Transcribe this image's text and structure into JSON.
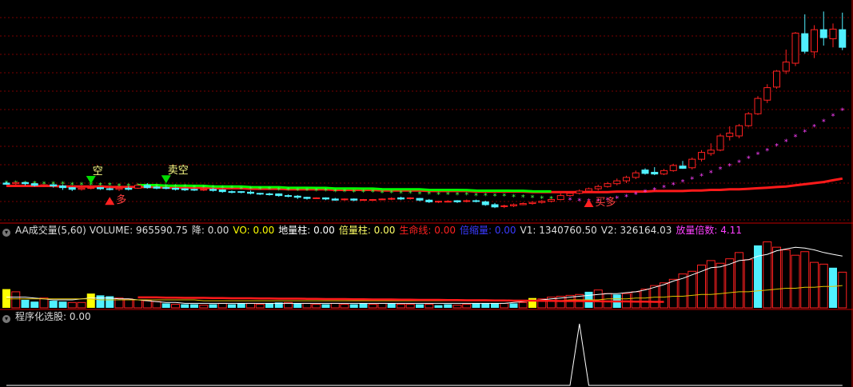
{
  "main_panel": {
    "signals": {
      "sell_short": "卖空",
      "short": "空",
      "many": "多",
      "buy_many": "买多"
    }
  },
  "volume_header": {
    "indicator": "AA成交量(5,60)",
    "items": [
      {
        "label": "VOLUME:",
        "value": "965590.75",
        "color": "#dddddd"
      },
      {
        "label": "降:",
        "value": "0.00",
        "color": "#dddddd"
      },
      {
        "label": "VO:",
        "value": "0.00",
        "color": "#ffff00"
      },
      {
        "label": "地量柱:",
        "value": "0.00",
        "color": "#ffffff"
      },
      {
        "label": "倍量柱:",
        "value": "0.00",
        "color": "#ffff66"
      },
      {
        "label": "生命线:",
        "value": "0.00",
        "color": "#ff2020"
      },
      {
        "label": "倍缩量:",
        "value": "0.00",
        "color": "#3a3aff"
      },
      {
        "label": "V1:",
        "value": "1340760.50",
        "color": "#dddddd"
      },
      {
        "label": "V2:",
        "value": "326164.03",
        "color": "#dddddd"
      },
      {
        "label": "放量倍数:",
        "value": "4.11",
        "color": "#ff40ff"
      }
    ]
  },
  "screener_header": {
    "label": "程序化选股",
    "value": ": 0.00"
  },
  "colors": {
    "up": "#ff2020",
    "down": "#50f0ff",
    "lifeline": "#ff1a1a",
    "trendline": "#00ff00",
    "dots": "#ff40ff",
    "grid": "#7a0000",
    "yellow_bar": "#ffff00"
  },
  "chart_data": [
    {
      "type": "candlestick",
      "candles": [
        [
          20.4,
          20.7,
          20.2,
          20.1
        ],
        [
          20.3,
          20.6,
          20.5,
          20.0
        ],
        [
          20.5,
          20.6,
          20.3,
          20.0
        ],
        [
          20.3,
          20.4,
          20.0,
          19.8
        ],
        [
          20.0,
          20.2,
          20.1,
          19.7
        ],
        [
          20.1,
          20.3,
          19.9,
          19.6
        ],
        [
          19.9,
          20.1,
          19.6,
          19.2
        ],
        [
          19.6,
          19.7,
          19.3,
          19.0
        ],
        [
          19.3,
          19.6,
          19.5,
          19.1
        ],
        [
          19.5,
          19.7,
          19.6,
          19.3
        ],
        [
          19.6,
          19.7,
          19.4,
          19.2
        ],
        [
          19.4,
          19.6,
          19.3,
          19.1
        ],
        [
          19.3,
          19.6,
          19.5,
          19.0
        ],
        [
          19.5,
          19.8,
          19.3,
          19.1
        ],
        [
          19.5,
          20.2,
          20.0,
          19.4
        ],
        [
          20.0,
          20.4,
          19.6,
          19.4
        ],
        [
          19.7,
          19.9,
          19.5,
          19.3
        ],
        [
          19.6,
          19.8,
          19.5,
          19.3
        ],
        [
          19.5,
          19.6,
          19.3,
          19.1
        ],
        [
          19.4,
          19.5,
          19.2,
          19.0
        ],
        [
          19.3,
          19.4,
          19.2,
          19.0
        ],
        [
          19.2,
          19.4,
          19.3,
          19.0
        ],
        [
          19.3,
          19.5,
          19.1,
          18.9
        ],
        [
          19.2,
          19.3,
          18.9,
          18.7
        ],
        [
          18.9,
          19.1,
          18.8,
          18.6
        ],
        [
          18.9,
          19.0,
          18.8,
          18.6
        ],
        [
          18.8,
          19.1,
          18.6,
          18.4
        ],
        [
          18.6,
          18.7,
          18.5,
          18.3
        ],
        [
          18.5,
          18.7,
          18.4,
          18.2
        ],
        [
          18.5,
          18.6,
          18.2,
          18.0
        ],
        [
          18.2,
          18.4,
          18.1,
          17.9
        ],
        [
          18.1,
          18.3,
          17.9,
          17.6
        ],
        [
          17.9,
          18.0,
          17.7,
          17.5
        ],
        [
          17.8,
          17.9,
          17.8,
          17.6
        ],
        [
          17.8,
          17.9,
          17.6,
          17.4
        ],
        [
          17.6,
          17.8,
          17.4,
          17.3
        ],
        [
          17.5,
          17.7,
          17.6,
          17.3
        ],
        [
          17.6,
          17.7,
          17.4,
          17.2
        ],
        [
          17.5,
          17.6,
          17.5,
          17.3
        ],
        [
          17.4,
          17.6,
          17.5,
          17.3
        ],
        [
          17.5,
          17.7,
          17.6,
          17.4
        ],
        [
          17.6,
          17.9,
          17.7,
          17.4
        ],
        [
          17.8,
          18.0,
          17.6,
          17.4
        ],
        [
          17.7,
          17.9,
          17.8,
          17.5
        ],
        [
          17.7,
          17.8,
          17.4,
          17.2
        ],
        [
          17.4,
          17.6,
          17.1,
          16.9
        ],
        [
          17.1,
          17.3,
          17.2,
          16.9
        ],
        [
          17.2,
          17.4,
          17.2,
          17.0
        ],
        [
          17.3,
          17.4,
          17.1,
          16.9
        ],
        [
          17.2,
          17.5,
          17.3,
          17.0
        ],
        [
          17.3,
          17.5,
          17.2,
          17.0
        ],
        [
          17.1,
          17.3,
          16.6,
          16.4
        ],
        [
          16.6,
          16.9,
          16.2,
          16.0
        ],
        [
          16.3,
          16.6,
          16.4,
          16.0
        ],
        [
          16.4,
          16.8,
          16.6,
          16.2
        ],
        [
          16.6,
          17.0,
          16.8,
          16.5
        ],
        [
          16.8,
          17.2,
          17.0,
          16.6
        ],
        [
          17.0,
          17.4,
          17.2,
          16.8
        ],
        [
          17.2,
          17.6,
          17.5,
          17.0
        ],
        [
          17.5,
          18.6,
          18.2,
          17.4
        ],
        [
          18.2,
          18.8,
          18.6,
          18.0
        ],
        [
          18.6,
          19.3,
          19.0,
          18.4
        ],
        [
          19.0,
          19.6,
          19.4,
          18.7
        ],
        [
          19.4,
          20.1,
          19.8,
          19.1
        ],
        [
          19.8,
          20.6,
          20.3,
          19.6
        ],
        [
          20.3,
          21.2,
          20.8,
          20.0
        ],
        [
          20.8,
          21.7,
          21.4,
          20.4
        ],
        [
          21.4,
          22.6,
          22.2,
          21.1
        ],
        [
          22.7,
          23.0,
          22.1,
          21.9
        ],
        [
          22.3,
          23.2,
          22.0,
          21.8
        ],
        [
          22.0,
          22.9,
          22.6,
          21.8
        ],
        [
          22.6,
          23.8,
          23.5,
          22.4
        ],
        [
          23.4,
          24.3,
          23.0,
          22.9
        ],
        [
          23.1,
          24.9,
          24.6,
          22.8
        ],
        [
          24.6,
          26.2,
          25.8,
          24.2
        ],
        [
          25.6,
          27.4,
          26.2,
          25.2
        ],
        [
          26.2,
          29.1,
          28.7,
          26.0
        ],
        [
          28.6,
          30.4,
          29.2,
          27.9
        ],
        [
          28.7,
          30.8,
          30.5,
          28.3
        ],
        [
          30.5,
          32.9,
          32.6,
          30.3
        ],
        [
          32.6,
          35.7,
          35.3,
          32.4
        ],
        [
          35.0,
          37.8,
          37.2,
          34.5
        ],
        [
          37.3,
          40.3,
          40.1,
          37.0
        ],
        [
          40.1,
          43.9,
          41.7,
          39.6
        ],
        [
          41.5,
          47.0,
          46.8,
          41.0
        ],
        [
          46.7,
          50.1,
          43.6,
          43.2
        ],
        [
          43.5,
          48.2,
          47.4,
          42.4
        ],
        [
          47.4,
          50.6,
          46.0,
          44.6
        ],
        [
          45.8,
          48.5,
          47.5,
          44.3
        ],
        [
          47.4,
          50.4,
          44.3,
          43.8
        ]
      ],
      "lifeline_values": [
        19.9,
        19.9,
        19.9,
        19.9,
        19.9,
        19.9,
        19.8,
        19.8,
        19.8,
        19.8,
        19.8,
        19.7,
        19.7,
        19.7,
        19.7,
        19.7,
        19.7,
        19.6,
        19.6,
        19.6,
        19.6,
        19.6,
        19.5,
        19.5,
        19.5,
        19.5,
        19.4,
        19.4,
        19.4,
        19.4,
        19.3,
        19.3,
        19.3,
        19.3,
        19.3,
        19.2,
        19.2,
        19.2,
        19.2,
        19.2,
        19.1,
        19.1,
        19.1,
        19.1,
        19.1,
        19.0,
        19.0,
        19.0,
        19.0,
        19.0,
        18.9,
        18.9,
        18.9,
        18.9,
        18.9,
        18.9,
        18.8,
        18.8,
        18.8,
        18.8,
        18.8,
        18.8,
        18.8,
        18.8,
        18.8,
        18.9,
        18.9,
        18.9,
        18.9,
        19.0,
        19.0,
        19.0,
        19.0,
        19.1,
        19.1,
        19.2,
        19.2,
        19.3,
        19.3,
        19.4,
        19.5,
        19.6,
        19.7,
        19.8,
        20.0,
        20.2,
        20.4,
        20.6,
        20.9,
        21.2
      ],
      "dot_values": [
        20.5,
        20.5,
        20.4,
        20.4,
        20.3,
        20.3,
        20.3,
        20.2,
        20.2,
        20.2,
        20.1,
        20.1,
        20.0,
        20.0,
        20.0,
        19.9,
        19.9,
        19.9,
        19.8,
        19.8,
        19.7,
        19.7,
        19.7,
        19.6,
        19.6,
        19.5,
        19.5,
        19.4,
        19.4,
        19.3,
        19.3,
        19.2,
        19.2,
        19.1,
        19.1,
        19.0,
        19.0,
        18.9,
        18.9,
        18.9,
        18.8,
        18.8,
        18.7,
        18.7,
        18.6,
        18.6,
        18.5,
        18.5,
        18.4,
        18.4,
        18.3,
        18.3,
        18.2,
        18.2,
        18.1,
        18.0,
        17.9,
        17.8,
        17.7,
        17.6,
        17.5,
        17.4,
        17.3,
        17.3,
        17.5,
        17.8,
        18.1,
        18.5,
        18.9,
        19.3,
        19.7,
        20.2,
        20.7,
        21.2,
        21.7,
        22.3,
        22.9,
        23.5,
        24.1,
        24.8,
        25.5,
        26.2,
        27.0,
        27.8,
        28.6,
        29.5,
        30.4,
        31.3,
        32.3,
        33.3
      ],
      "trend_start_index": 14,
      "trend_end_index": 58,
      "signals": [
        {
          "index": 9,
          "label": "空",
          "direction": "down-arrow"
        },
        {
          "index": 11,
          "label": "多",
          "direction": "up-arrow"
        },
        {
          "index": 17,
          "label": "卖空",
          "direction": "down-arrow"
        },
        {
          "index": 62,
          "label": "买多",
          "direction": "up-arrow"
        }
      ]
    },
    {
      "type": "bar",
      "volumes": [
        2.1,
        1.8,
        0.9,
        0.7,
        1.1,
        0.8,
        0.7,
        0.6,
        0.6,
        1.6,
        1.4,
        1.3,
        1.1,
        1.0,
        0.9,
        0.8,
        0.7,
        0.5,
        0.4,
        0.4,
        0.4,
        0.3,
        0.4,
        0.5,
        0.4,
        0.5,
        0.5,
        0.4,
        0.5,
        0.6,
        0.6,
        0.5,
        0.5,
        0.4,
        0.4,
        0.5,
        0.4,
        0.4,
        0.5,
        0.4,
        0.5,
        0.5,
        0.4,
        0.4,
        0.4,
        0.4,
        0.3,
        0.4,
        0.3,
        0.4,
        0.5,
        0.5,
        0.5,
        0.5,
        0.5,
        0.6,
        1.1,
        1.0,
        1.2,
        1.3,
        1.4,
        1.5,
        1.8,
        2.0,
        1.6,
        1.5,
        1.6,
        1.8,
        2.1,
        2.5,
        2.8,
        3.2,
        3.8,
        4.1,
        4.8,
        5.3,
        5.0,
        5.5,
        6.2,
        5.4,
        7.0,
        7.4,
        6.8,
        6.5,
        5.9,
        6.3,
        5.1,
        4.9,
        4.5,
        4.0
      ],
      "volume_colors": [
        "y",
        "u",
        "d",
        "d",
        "u",
        "d",
        "d",
        "u",
        "u",
        "y",
        "d",
        "d",
        "u",
        "u",
        "u",
        "u",
        "u",
        "d",
        "u",
        "d",
        "d",
        "u",
        "d",
        "u",
        "d",
        "d",
        "u",
        "u",
        "d",
        "d",
        "u",
        "d",
        "u",
        "u",
        "d",
        "u",
        "u",
        "d",
        "d",
        "u",
        "u",
        "d",
        "u",
        "u",
        "d",
        "u",
        "d",
        "d",
        "u",
        "u",
        "d",
        "d",
        "d",
        "u",
        "d",
        "u",
        "y",
        "u",
        "u",
        "u",
        "u",
        "u",
        "d",
        "u",
        "u",
        "d",
        "u",
        "u",
        "u",
        "u",
        "u",
        "u",
        "u",
        "u",
        "u",
        "u",
        "u",
        "u",
        "u",
        "u",
        "d",
        "u",
        "u",
        "u",
        "u",
        "u",
        "u",
        "u",
        "d",
        "u"
      ],
      "ma5_values": [
        1.2,
        1.2,
        1.2,
        1.1,
        1.0,
        0.9,
        0.9,
        0.9,
        1.0,
        1.1,
        1.1,
        1.1,
        1.0,
        1.0,
        0.9,
        0.8,
        0.7,
        0.6,
        0.6,
        0.5,
        0.5,
        0.5,
        0.5,
        0.5,
        0.5,
        0.5,
        0.5,
        0.5,
        0.5,
        0.5,
        0.5,
        0.5,
        0.5,
        0.5,
        0.5,
        0.5,
        0.5,
        0.5,
        0.5,
        0.5,
        0.5,
        0.5,
        0.5,
        0.5,
        0.5,
        0.5,
        0.5,
        0.5,
        0.5,
        0.5,
        0.5,
        0.5,
        0.5,
        0.5,
        0.6,
        0.7,
        0.8,
        0.9,
        1.0,
        1.1,
        1.2,
        1.3,
        1.4,
        1.5,
        1.6,
        1.6,
        1.7,
        1.8,
        2.0,
        2.3,
        2.6,
        3.0,
        3.3,
        3.7,
        4.1,
        4.5,
        4.6,
        4.9,
        5.3,
        5.4,
        5.8,
        6.0,
        6.4,
        6.6,
        6.8,
        6.7,
        6.5,
        6.2,
        6.0,
        5.8
      ],
      "ma60_values": [
        1.0,
        1.0,
        1.0,
        1.0,
        1.0,
        1.0,
        1.0,
        1.0,
        1.0,
        1.0,
        0.9,
        0.9,
        0.9,
        0.9,
        0.9,
        0.9,
        0.9,
        0.9,
        0.9,
        0.9,
        0.9,
        0.8,
        0.8,
        0.8,
        0.8,
        0.8,
        0.8,
        0.8,
        0.8,
        0.8,
        0.8,
        0.8,
        0.8,
        0.8,
        0.8,
        0.8,
        0.8,
        0.8,
        0.8,
        0.8,
        0.8,
        0.8,
        0.8,
        0.8,
        0.8,
        0.8,
        0.8,
        0.8,
        0.8,
        0.8,
        0.8,
        0.8,
        0.8,
        0.8,
        0.8,
        0.8,
        0.8,
        0.8,
        0.8,
        0.8,
        0.9,
        0.9,
        0.9,
        0.9,
        1.0,
        1.0,
        1.0,
        1.1,
        1.1,
        1.2,
        1.2,
        1.3,
        1.3,
        1.4,
        1.5,
        1.5,
        1.6,
        1.7,
        1.8,
        1.8,
        1.9,
        2.0,
        2.1,
        2.2,
        2.2,
        2.3,
        2.3,
        2.4,
        2.4,
        2.5
      ],
      "lifeline_volume": [
        2.6,
        2.6,
        2.6,
        2.55,
        2.55,
        2.5,
        2.5,
        2.5,
        2.45,
        2.45,
        2.4,
        2.4,
        2.4,
        2.35,
        2.35,
        2.3,
        2.3,
        2.3,
        2.25,
        2.25,
        2.2,
        2.2,
        2.2,
        2.15,
        2.15,
        2.1,
        2.1,
        2.1,
        2.05,
        2.05,
        2.0,
        2.0,
        2.0,
        1.95,
        1.95,
        1.9,
        1.9,
        1.9,
        1.85,
        1.85,
        1.8,
        1.8,
        1.8,
        1.75,
        1.75,
        1.7,
        1.7,
        1.7,
        1.65,
        1.65,
        1.6,
        1.6,
        1.6,
        1.55,
        1.55,
        1.5,
        1.5
      ]
    },
    {
      "type": "line",
      "values": [
        0,
        0,
        0,
        0,
        0,
        0,
        0,
        0,
        0,
        0,
        0,
        0,
        0,
        0,
        0,
        0,
        0,
        0,
        0,
        0,
        0,
        0,
        0,
        0,
        0,
        0,
        0,
        0,
        0,
        0,
        0,
        0,
        0,
        0,
        0,
        0,
        0,
        0,
        0,
        0,
        0,
        0,
        0,
        0,
        0,
        0,
        0,
        0,
        0,
        0,
        0,
        0,
        0,
        0,
        0,
        0,
        0,
        0,
        0,
        0,
        0,
        1,
        0,
        0,
        0,
        0,
        0,
        0,
        0,
        0,
        0,
        0,
        0,
        0,
        0,
        0,
        0,
        0,
        0,
        0,
        0,
        0,
        0,
        0,
        0,
        0,
        0,
        0,
        0,
        0
      ]
    }
  ]
}
